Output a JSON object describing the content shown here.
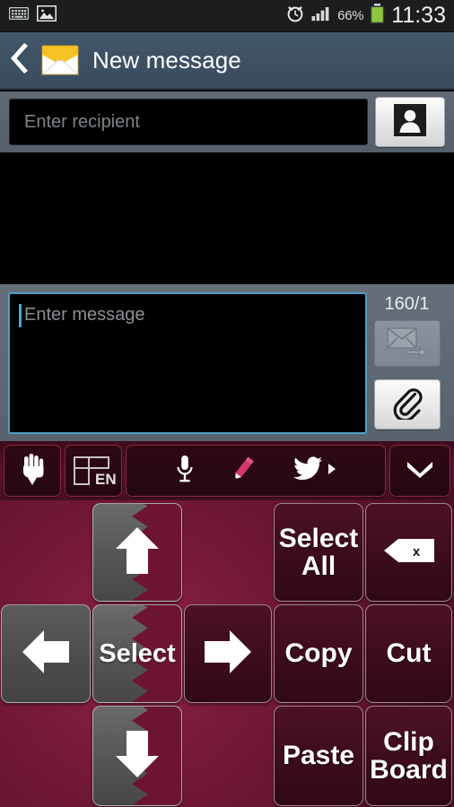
{
  "statusbar": {
    "icons_left": [
      "keyboard-icon",
      "image-icon"
    ],
    "alarm_icon": "alarm-clock-icon",
    "signal_icon": "signal-bars-icon",
    "battery_percent": "66%",
    "battery_icon": "battery-icon",
    "battery_color": "#8dc63f",
    "time": "11:33"
  },
  "actionbar": {
    "back_icon": "back-chevron-icon",
    "app_icon": "envelope-icon",
    "title": "New message",
    "bg_color": "#3d5064"
  },
  "recipient": {
    "placeholder": "Enter recipient",
    "value": "",
    "contacts_icon": "contact-person-icon"
  },
  "compose": {
    "message_placeholder": "Enter message",
    "message_value": "",
    "char_counter": "160/1",
    "send_icon": "send-message-icon",
    "attach_icon": "paperclip-icon",
    "border_color": "#4c9fc4"
  },
  "keyboard_toolbar": {
    "keys": [
      {
        "name": "one-hand-mode-key",
        "icon": "hand-down-arrow-icon",
        "label": ""
      },
      {
        "name": "language-key",
        "icon": "keyboard-layout-icon",
        "label": "EN"
      },
      {
        "name": "input-options-bar",
        "icons": [
          "microphone-icon",
          "pencil-icon",
          "twitter-bird-icon",
          "play-triangle-icon"
        ]
      },
      {
        "name": "hide-keyboard-key",
        "icon": "chevron-down-icon",
        "label": ""
      }
    ]
  },
  "keypad": {
    "keys": [
      {
        "name": "arrow-up-key",
        "label": "",
        "icon": "arrow-up-icon",
        "style": "flag"
      },
      {
        "name": "select-all-key",
        "label": "Select\nAll",
        "icon": "",
        "style": "maroon"
      },
      {
        "name": "backspace-key",
        "label": "",
        "icon": "backspace-icon",
        "style": "maroon"
      },
      {
        "name": "arrow-left-key",
        "label": "",
        "icon": "arrow-left-icon",
        "style": "grey"
      },
      {
        "name": "select-key",
        "label": "Select",
        "icon": "",
        "style": "flag"
      },
      {
        "name": "arrow-right-key",
        "label": "",
        "icon": "arrow-right-icon",
        "style": "maroon"
      },
      {
        "name": "copy-key",
        "label": "Copy",
        "icon": "",
        "style": "maroon"
      },
      {
        "name": "cut-key",
        "label": "Cut",
        "icon": "",
        "style": "maroon"
      },
      {
        "name": "arrow-down-key",
        "label": "",
        "icon": "arrow-down-icon",
        "style": "flag"
      },
      {
        "name": "paste-key",
        "label": "Paste",
        "icon": "",
        "style": "maroon"
      },
      {
        "name": "clipboard-key",
        "label": "Clip\nBoard",
        "icon": "",
        "style": "maroon"
      }
    ],
    "labels": {
      "select_all": "Select All",
      "select": "Select",
      "copy": "Copy",
      "cut": "Cut",
      "paste": "Paste",
      "clipboard": "Clip Board",
      "select_all_l1": "Select",
      "select_all_l2": "All",
      "clipboard_l1": "Clip",
      "clipboard_l2": "Board"
    },
    "accent_color": "#7a1a3a"
  }
}
